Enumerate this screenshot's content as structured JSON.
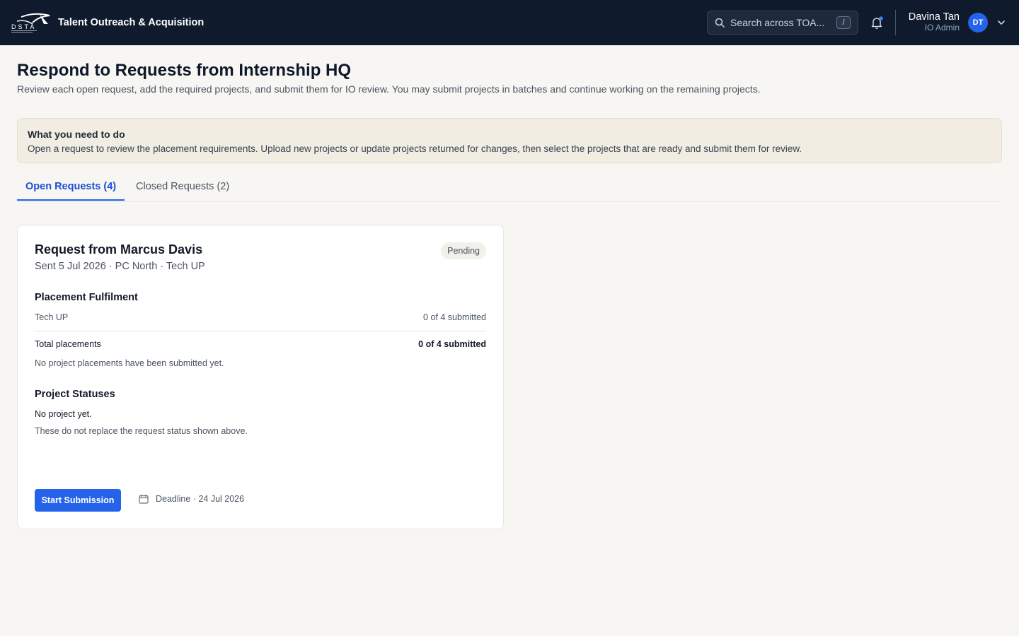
{
  "header": {
    "logo_text": "DSTA",
    "app_title": "Talent Outreach & Acquisition",
    "search": {
      "placeholder": "Search across TOA...",
      "shortcut": "/"
    },
    "user": {
      "name": "Davina Tan",
      "role": "IO Admin",
      "initials": "DT"
    },
    "accent": "#2563eb"
  },
  "page": {
    "title": "Respond to Requests from Internship HQ",
    "subtitle": "Review each open request, add the required projects, and submit them for IO review. You may submit projects in batches and continue working on the remaining projects."
  },
  "info": {
    "title": "What you need to do",
    "text": "Open a request to review the placement requirements. Upload new projects or update projects returned for changes, then select the projects that are ready and submit them for review."
  },
  "tabs": [
    {
      "label": "Open Requests (4)",
      "active": true
    },
    {
      "label": "Closed Requests (2)",
      "active": false
    }
  ],
  "request_card": {
    "title": "Request from Marcus Davis",
    "meta": "Sent 5 Jul 2026 · PC North · Tech UP",
    "status": "Pending",
    "placement": {
      "heading": "Placement Fulfilment",
      "rows": [
        {
          "label": "Tech UP",
          "value": "0 of 4 submitted"
        }
      ],
      "total": {
        "label": "Total placements",
        "value": "0 of 4 submitted"
      },
      "note": "No project placements have been submitted yet."
    },
    "project_statuses": {
      "heading": "Project Statuses",
      "empty": "No project yet.",
      "note": "These do not replace the request status shown above."
    },
    "action_label": "Start Submission",
    "deadline": "Deadline · 24 Jul 2026"
  }
}
